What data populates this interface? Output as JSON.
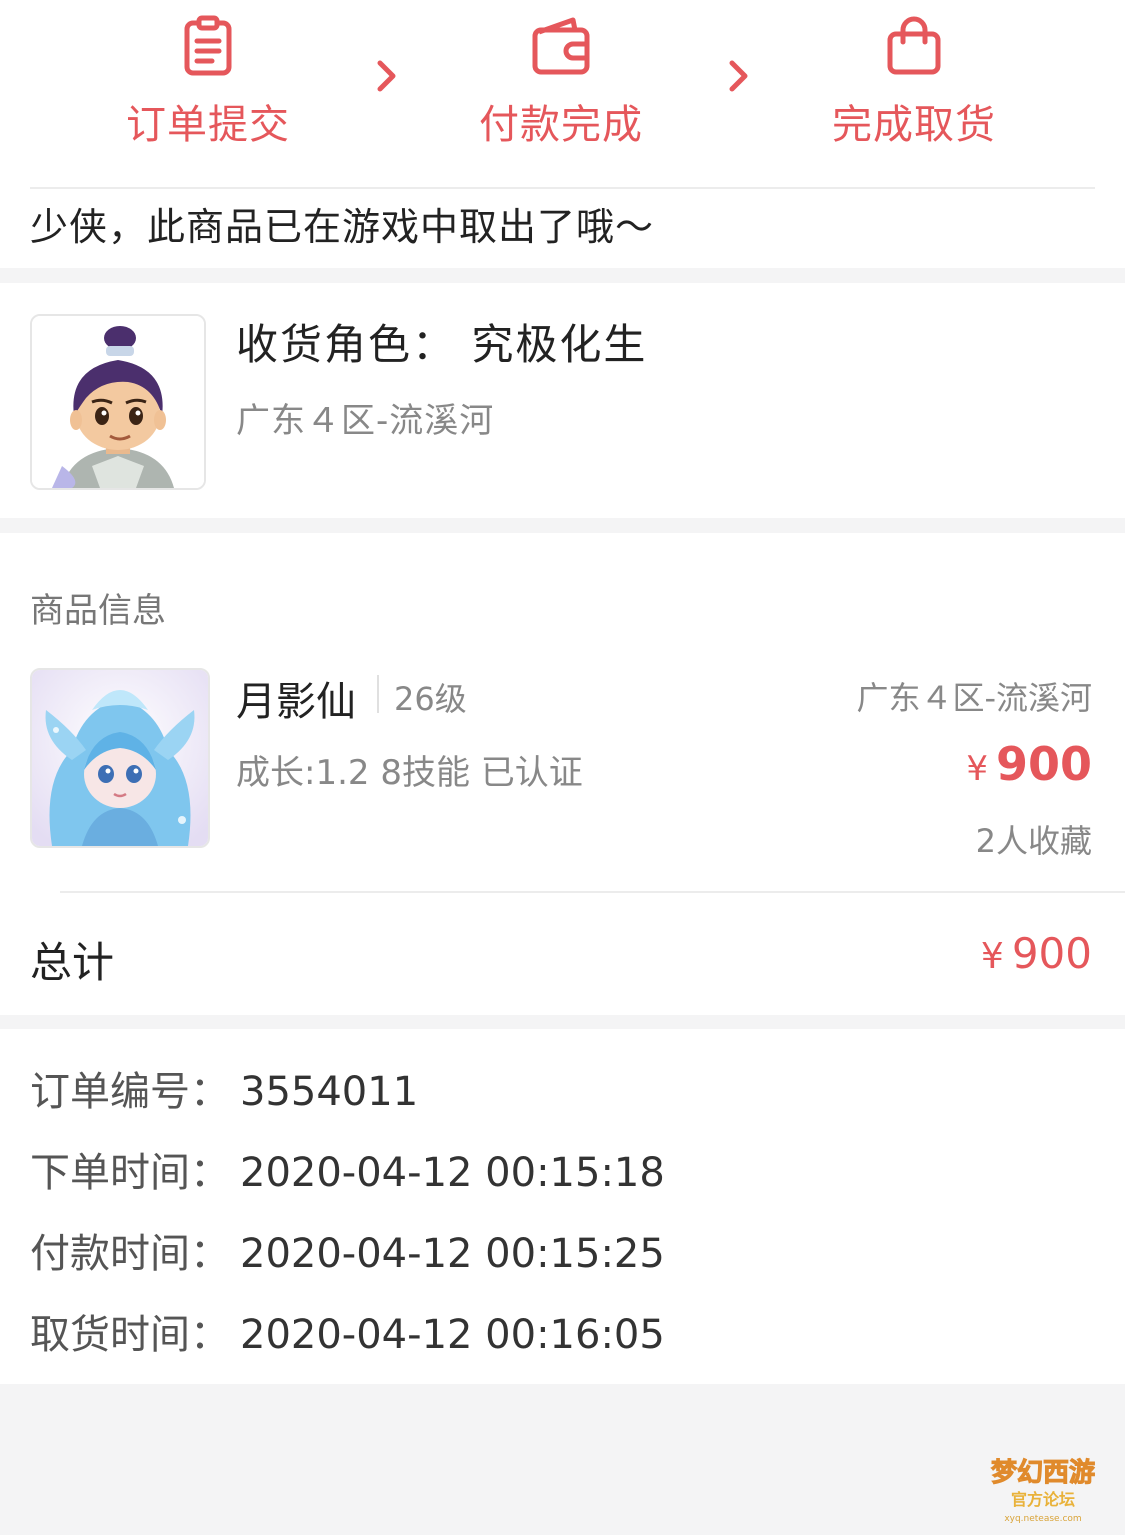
{
  "steps": [
    {
      "label": "订单提交",
      "icon": "clipboard-icon"
    },
    {
      "label": "付款完成",
      "icon": "wallet-icon"
    },
    {
      "label": "完成取货",
      "icon": "shopping-bag-icon"
    }
  ],
  "notice": "少侠，此商品已在游戏中取出了哦～",
  "receiver": {
    "title": "收货角色： 究极化生",
    "server": "广东４区-流溪河"
  },
  "goods": {
    "section_title": "商品信息",
    "name": "月影仙",
    "level": "26级",
    "attributes": "成长:1.2 8技能 已认证",
    "server": "广东４区-流溪河",
    "currency": "¥",
    "price": "900",
    "favorites": "2人收藏"
  },
  "total": {
    "label": "总计",
    "currency": "¥",
    "value": "900"
  },
  "order": {
    "rows": [
      {
        "key": "订单编号：",
        "value": "3554011"
      },
      {
        "key": "下单时间：",
        "value": "2020-04-12 00:15:18"
      },
      {
        "key": "付款时间：",
        "value": "2020-04-12 00:15:25"
      },
      {
        "key": "取货时间：",
        "value": "2020-04-12 00:16:05"
      }
    ]
  },
  "watermark": {
    "line1": "梦幻西游",
    "line2": "官方论坛",
    "line3": "xyq.netease.com"
  },
  "colors": {
    "accent": "#e5575b",
    "muted": "#888888",
    "background": "#f4f4f5"
  }
}
